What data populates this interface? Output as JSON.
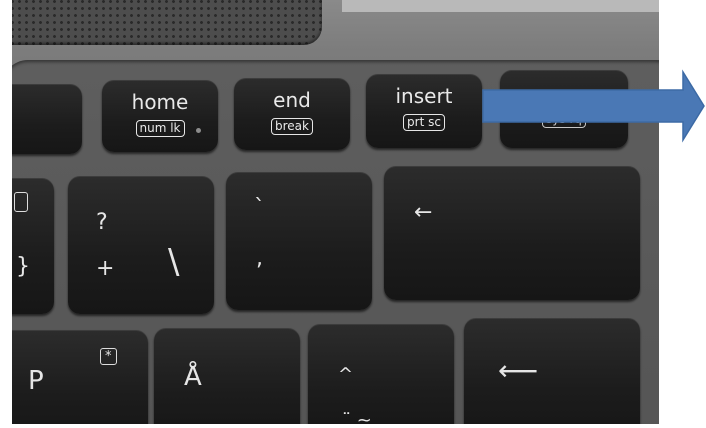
{
  "keys": {
    "home": {
      "primary": "home",
      "secondary": "num lk"
    },
    "end": {
      "primary": "end",
      "secondary": "break"
    },
    "insert": {
      "primary": "insert",
      "secondary": "prt sc"
    },
    "sysrq": {
      "secondary": "sys rq"
    },
    "question": {
      "top": "?",
      "bottom": "+"
    },
    "backslash": {
      "glyph": "\\"
    },
    "accent": {
      "top": "`",
      "bottom": ","
    },
    "backspace": {
      "glyph": "←"
    },
    "p": {
      "main": "P",
      "alt": "*"
    },
    "aring": {
      "main": "Å"
    },
    "umlaut": {
      "top": "^",
      "bottom": "¨ ~"
    },
    "enter": {
      "glyph": "⟵"
    },
    "curly": {
      "glyph": "}"
    }
  },
  "annotation": {
    "type": "arrow",
    "color": "#4a78b5",
    "points_to": "sysrq-key"
  }
}
